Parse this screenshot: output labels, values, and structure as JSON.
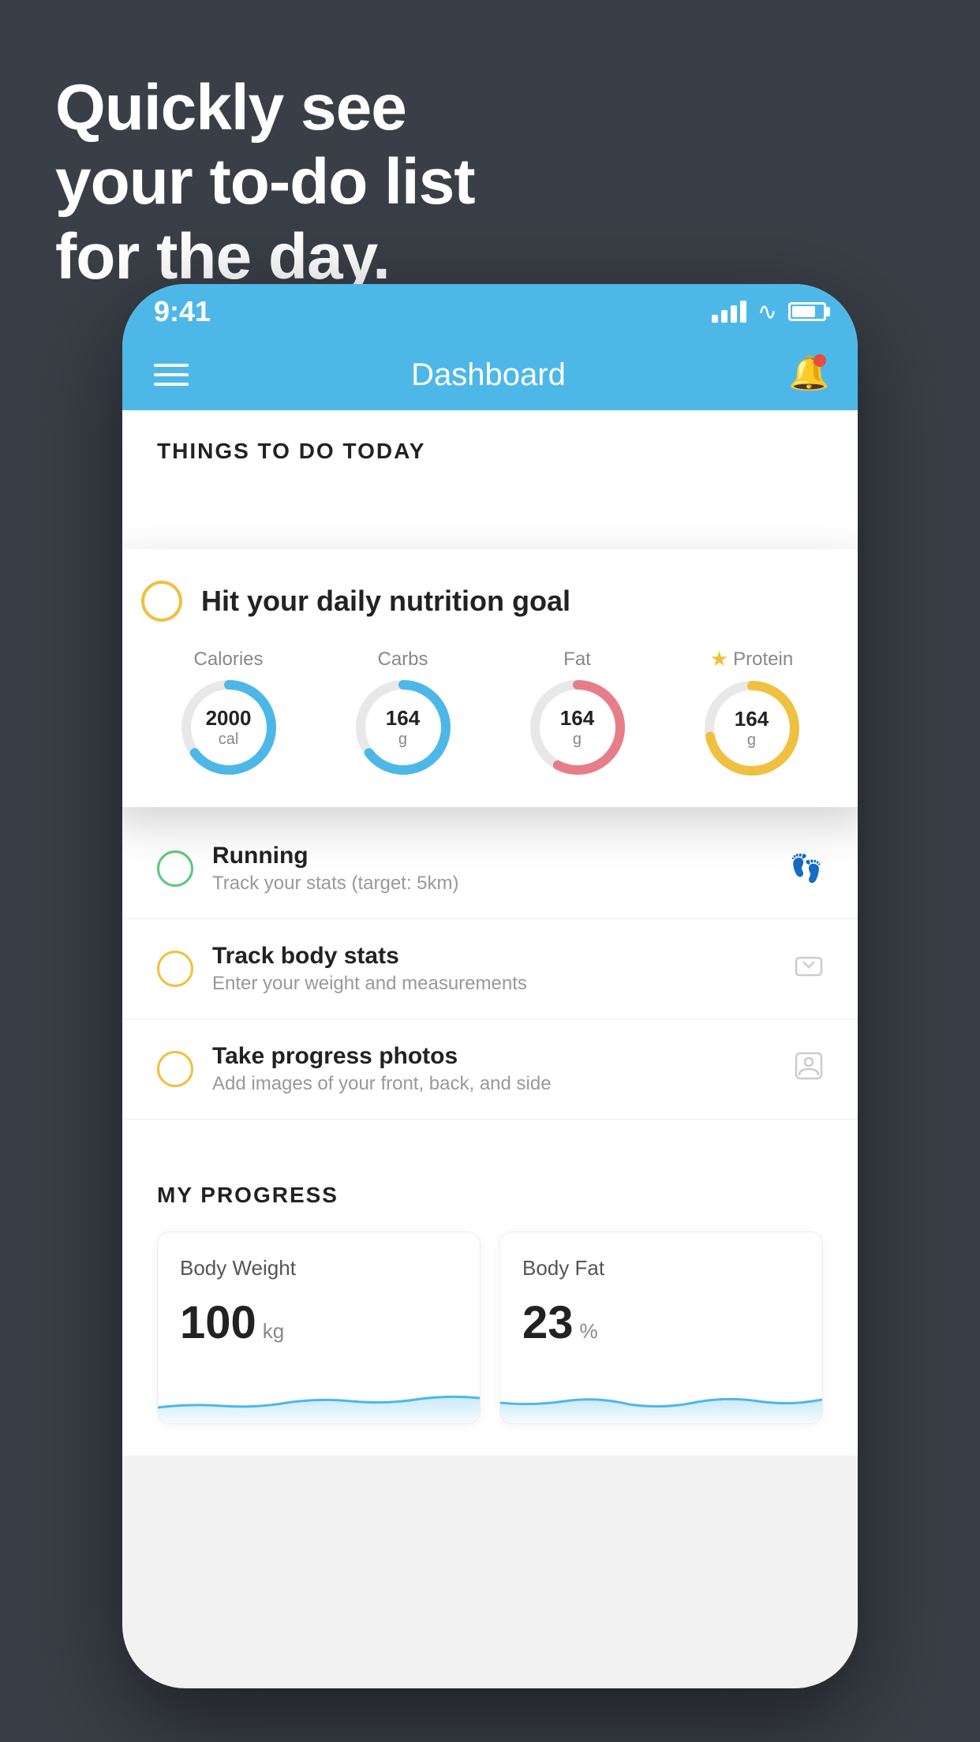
{
  "headline": {
    "line1": "Quickly see",
    "line2": "your to-do list",
    "line3": "for the day."
  },
  "phone": {
    "status_bar": {
      "time": "9:41"
    },
    "header": {
      "title": "Dashboard"
    },
    "things_section": {
      "title": "THINGS TO DO TODAY"
    },
    "floating_card": {
      "circle_label": "",
      "title": "Hit your daily nutrition goal",
      "items": [
        {
          "label": "Calories",
          "value": "2000",
          "unit": "cal",
          "type": "blue"
        },
        {
          "label": "Carbs",
          "value": "164",
          "unit": "g",
          "type": "blue"
        },
        {
          "label": "Fat",
          "value": "164",
          "unit": "g",
          "type": "pink"
        },
        {
          "label": "Protein",
          "value": "164",
          "unit": "g",
          "type": "gold",
          "star": true
        }
      ]
    },
    "todo_items": [
      {
        "title": "Running",
        "subtitle": "Track your stats (target: 5km)",
        "circle": "green",
        "icon": "shoe"
      },
      {
        "title": "Track body stats",
        "subtitle": "Enter your weight and measurements",
        "circle": "yellow",
        "icon": "scale"
      },
      {
        "title": "Take progress photos",
        "subtitle": "Add images of your front, back, and side",
        "circle": "yellow",
        "icon": "person"
      }
    ],
    "progress": {
      "title": "MY PROGRESS",
      "cards": [
        {
          "title": "Body Weight",
          "value": "100",
          "unit": "kg"
        },
        {
          "title": "Body Fat",
          "value": "23",
          "unit": "%"
        }
      ]
    }
  }
}
